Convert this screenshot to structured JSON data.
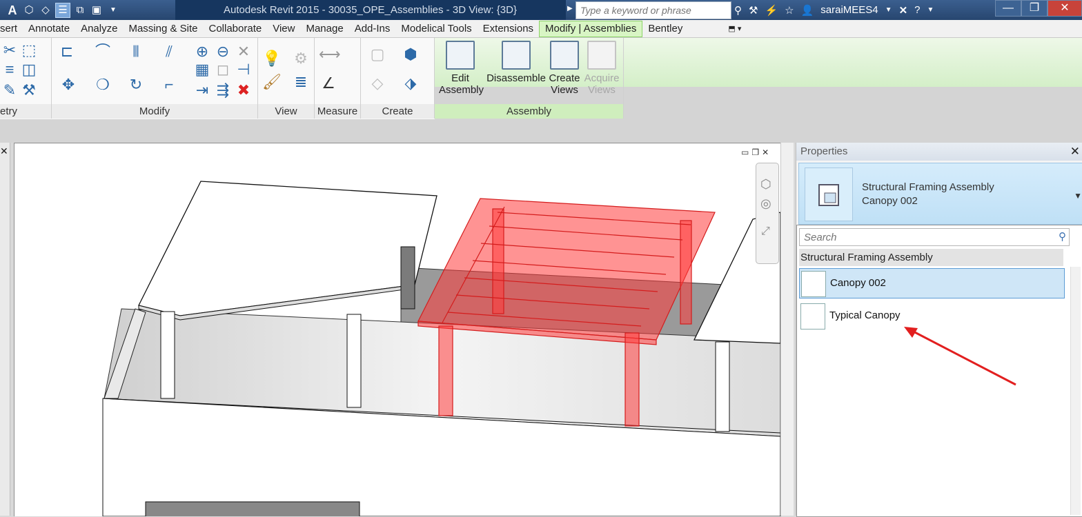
{
  "titlebar": {
    "title": "Autodesk Revit 2015 -     30035_OPE_Assemblies - 3D View: {3D}",
    "search_placeholder": "Type a keyword or phrase",
    "user": "saraiMEES4"
  },
  "tabs": [
    "sert",
    "Annotate",
    "Analyze",
    "Massing & Site",
    "Collaborate",
    "View",
    "Manage",
    "Add-Ins",
    "Modelical Tools",
    "Extensions",
    "Modify | Assemblies",
    "Bentley"
  ],
  "active_tab": "Modify | Assemblies",
  "ribbon": {
    "panels": [
      "etry",
      "Modify",
      "View",
      "Measure",
      "Create",
      "Assembly"
    ],
    "assembly_buttons": {
      "edit": [
        "Edit",
        "Assembly"
      ],
      "disassemble": "Disassemble",
      "create_views": [
        "Create",
        "Views"
      ],
      "acquire_views": [
        "Acquire",
        "Views"
      ]
    }
  },
  "properties": {
    "header": "Properties",
    "type_line1": "Structural Framing Assembly",
    "type_line2": "Canopy 002",
    "search_placeholder": "Search",
    "group": "Structural Framing Assembly",
    "items": [
      {
        "label": "Canopy 002",
        "selected": true
      },
      {
        "label": "Typical Canopy",
        "selected": false
      }
    ]
  },
  "colors": {
    "selection_red": "#ff3b3b",
    "contextual_green": "#8bd366",
    "annotation_arrow": "#e21f1f"
  }
}
